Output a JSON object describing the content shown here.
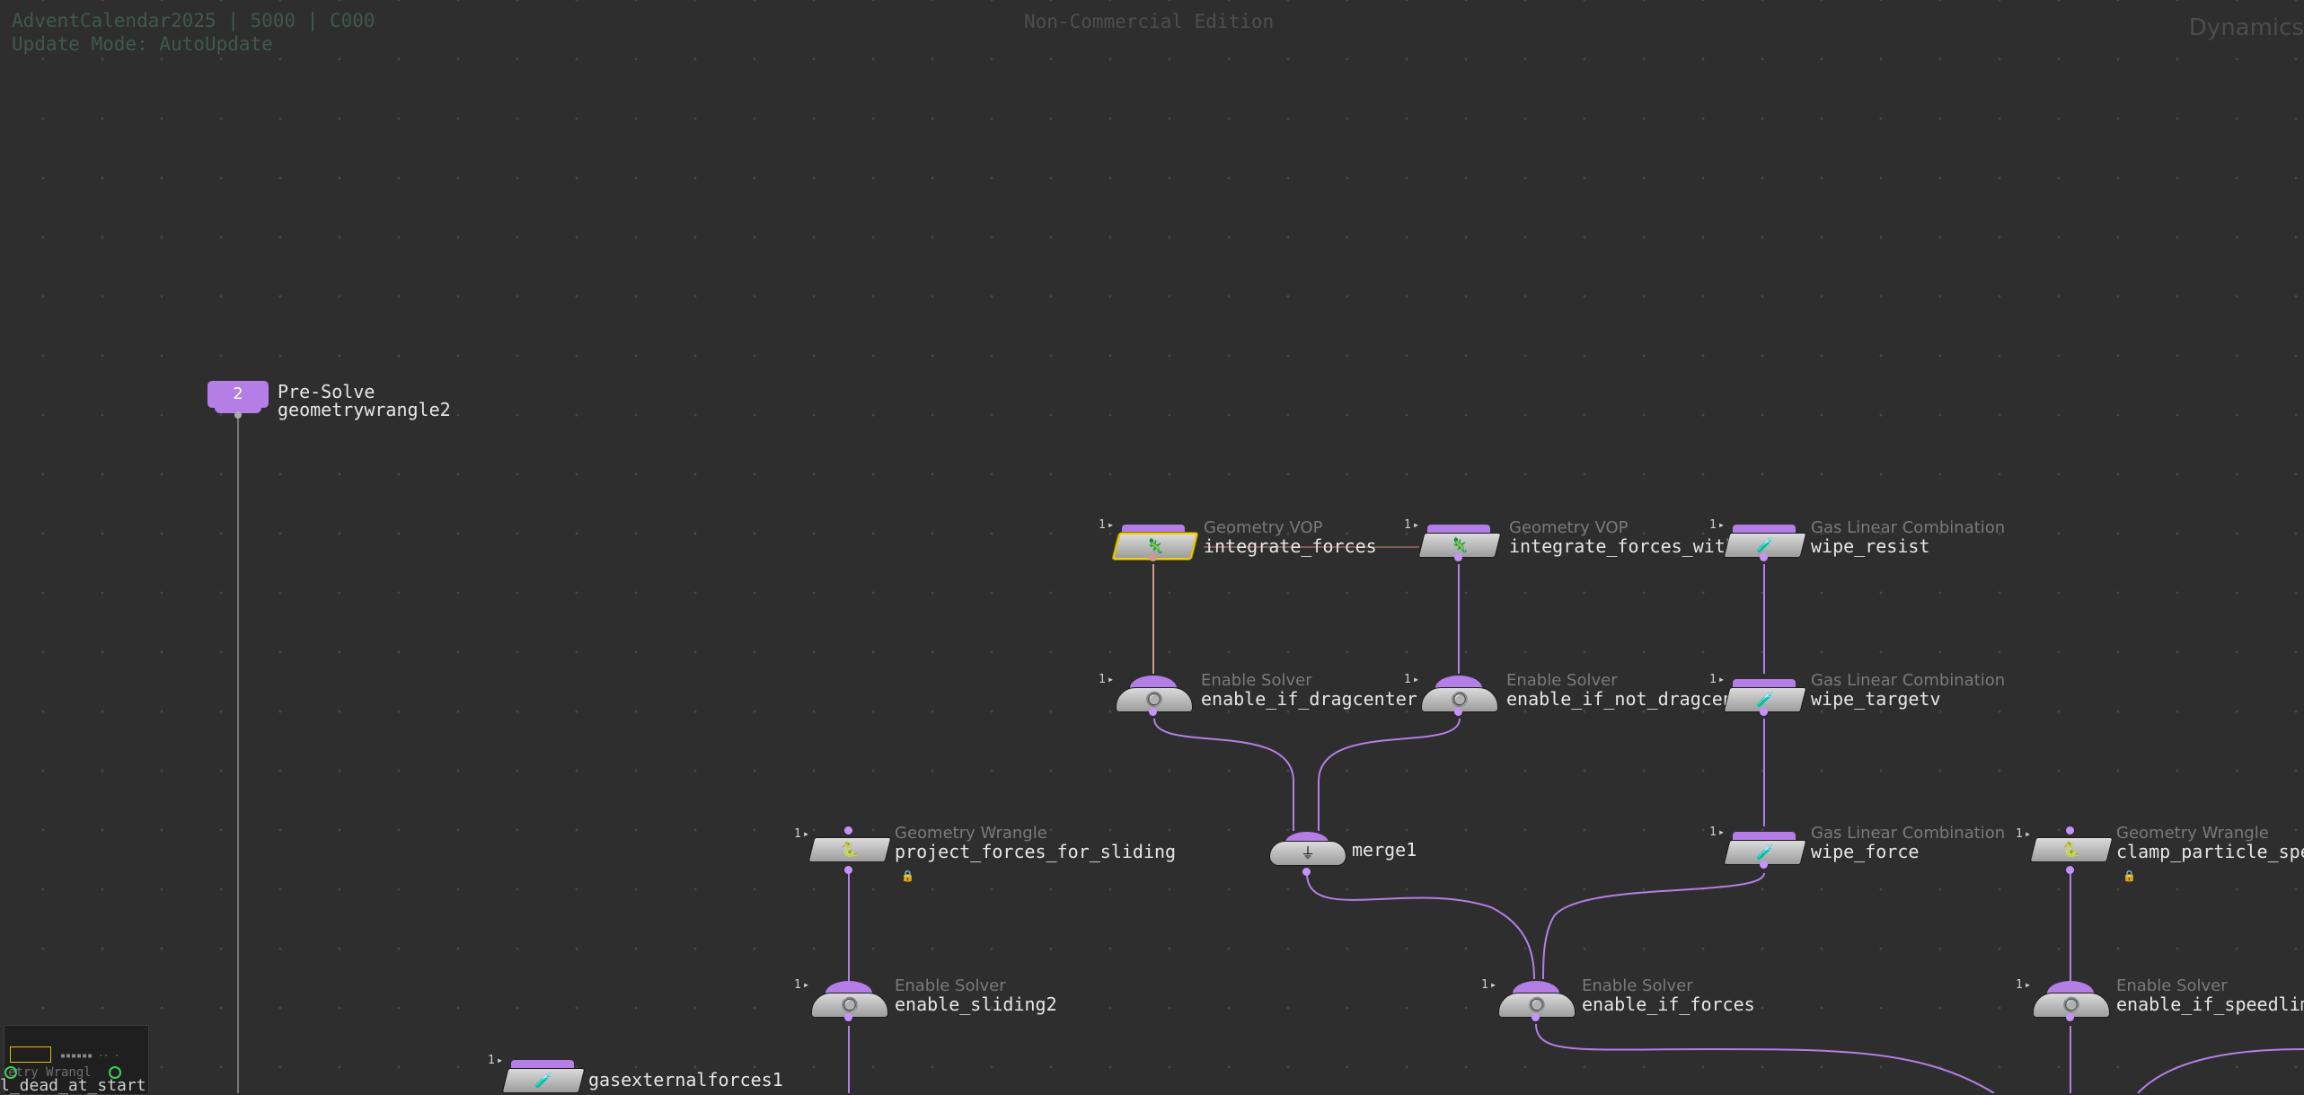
{
  "hud": {
    "project": "AdventCalendar2025 | 5000 | C000",
    "update_mode": "Update Mode: AutoUpdate",
    "edition": "Non-Commercial Edition",
    "context": "Dynamics"
  },
  "network_box": {
    "count": "2",
    "title": "Pre-Solve",
    "subtitle": "geometrywrangle2"
  },
  "nodes": {
    "integrate_forces": {
      "type": "Geometry VOP",
      "name": "integrate_forces",
      "gen": "1"
    },
    "integrate_forces_with": {
      "type": "Geometry VOP",
      "name": "integrate_forces_with",
      "gen": "1"
    },
    "wipe_resist": {
      "type": "Gas Linear Combination",
      "name": "wipe_resist",
      "gen": "1"
    },
    "enable_if_dragcenter": {
      "type": "Enable Solver",
      "name": "enable_if_dragcenter",
      "gen": "1"
    },
    "enable_if_not_dragcen": {
      "type": "Enable Solver",
      "name": "enable_if_not_dragcen",
      "gen": "1"
    },
    "wipe_targetv": {
      "type": "Gas Linear Combination",
      "name": "wipe_targetv",
      "gen": "1"
    },
    "project_forces": {
      "type": "Geometry Wrangle",
      "name": "project_forces_for_sliding",
      "gen": "1"
    },
    "merge1": {
      "name": "merge1"
    },
    "wipe_force": {
      "type": "Gas Linear Combination",
      "name": "wipe_force",
      "gen": "1"
    },
    "clamp_particle": {
      "type": "Geometry Wrangle",
      "name": "clamp_particle_spe",
      "gen": "1"
    },
    "enable_sliding2": {
      "type": "Enable Solver",
      "name": "enable_sliding2",
      "gen": "1"
    },
    "enable_if_forces": {
      "type": "Enable Solver",
      "name": "enable_if_forces",
      "gen": "1"
    },
    "enable_if_speedlim": {
      "type": "Enable Solver",
      "name": "enable_if_speedlim",
      "gen": "1"
    },
    "gasexternalforces1": {
      "name": "gasexternalforces1",
      "gen": "1"
    }
  },
  "minimap": {
    "text": "etry Wrangl"
  },
  "bottom_label": "l_dead_at_start",
  "icons": {
    "vop": "vop-icon",
    "gas": "gas-linear-icon",
    "solver": "enable-solver-icon",
    "wrangle": "wrangle-icon",
    "merge": "merge-icon"
  }
}
